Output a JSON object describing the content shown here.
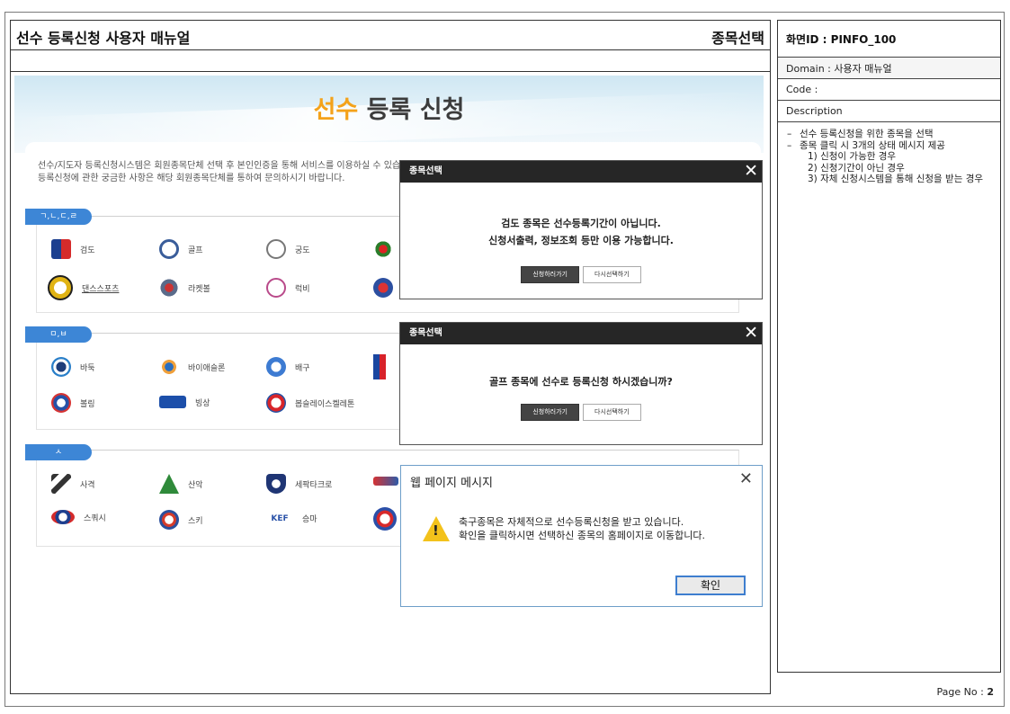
{
  "header": {
    "doc_title": "선수 등록신청 사용자 매뉴얼",
    "screen_name": "종목선택"
  },
  "panel": {
    "screen_id": "화면ID : PINFO_100",
    "domain": "Domain : 사용자 매뉴얼",
    "code": "Code :",
    "description_label": "Description",
    "items": [
      "선수 등록신청을 위한 종목을 선택",
      "종목 클릭 시 3개의 상태 메시지 제공"
    ],
    "sub_items": [
      "1) 신청이 가능한 경우",
      "2) 신청기간이 아닌 경우",
      "3) 자체 신청시스템을 통해 신청을 받는 경우"
    ],
    "page_label": "Page No :",
    "page_num": "2"
  },
  "page": {
    "title_accent": "선수",
    "title_rest": "등록 신청",
    "intro_line1": "선수/지도자 등록신청시스템은 회원종목단체 선택 후 본인인증을 통해 서비스를 이용하실 수 있습니다.",
    "intro_line2": "등록신청에 관한 궁금한 사항은 해당 회원종목단체를 통하여 문의하시기 바랍니다.",
    "sections": [
      {
        "tab": "ㄱ,ㄴ,ㄷ,ㄹ",
        "sports": [
          "검도",
          "골프",
          "궁도",
          "댄스스포츠",
          "라켓볼",
          "럭비"
        ]
      },
      {
        "tab": "ㅁ,ㅂ",
        "sports": [
          "바둑",
          "바이애슬론",
          "배구",
          "볼링",
          "빙상",
          "봅슬레이스켈레톤"
        ]
      },
      {
        "tab": "ㅅ",
        "sports": [
          "사격",
          "산악",
          "세팍타크로",
          "스쿼시",
          "스키",
          "승마"
        ]
      }
    ]
  },
  "dialog1": {
    "title": "종목선택",
    "message_line1": "검도 종목은 선수등록기간이 아닙니다.",
    "message_line2": "신청서출력, 정보조회 등만 이용 가능합니다.",
    "apply_label": "신청하러가기",
    "reselect_label": "다시선택하기"
  },
  "dialog2": {
    "title": "종목선택",
    "message": "골프 종목에 선수로 등록신청 하시겠습니까?",
    "apply_label": "신청하러가기",
    "reselect_label": "다시선택하기"
  },
  "alert": {
    "title": "웹 페이지 메시지",
    "message_line1": "축구종목은 자체적으로 선수등록신청을 받고 있습니다.",
    "message_line2": "확인을 클릭하시면 선택하신 종목의 홈페이지로 이동합니다.",
    "ok_label": "확인"
  },
  "colors": {
    "accent_orange": "#f4a21a",
    "tab_blue": "#3d86d6",
    "dialog_bar": "#262626",
    "warning_yellow": "#f3c21b"
  }
}
